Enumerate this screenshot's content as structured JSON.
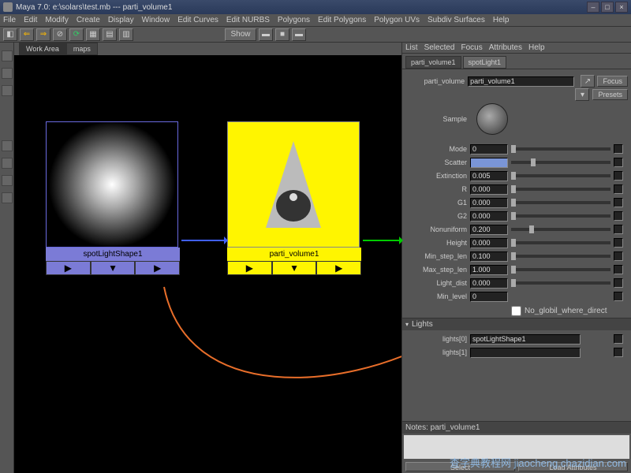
{
  "title": "Maya 7.0: e:\\solars\\test.mb --- parti_volume1",
  "menus": [
    "File",
    "Edit",
    "Modify",
    "Create",
    "Display",
    "Window",
    "Edit Curves",
    "Edit NURBS",
    "Polygons",
    "Edit Polygons",
    "Polygon UVs",
    "Subdiv Surfaces",
    "Help"
  ],
  "graph": {
    "tabs": [
      "Work Area",
      "maps"
    ],
    "node1_label": "spotLightShape1",
    "node2_label": "parti_volume1",
    "toolbar_show": "Show"
  },
  "attr": {
    "menus": [
      "List",
      "Selected",
      "Focus",
      "Attributes",
      "Help"
    ],
    "tabs": [
      "parti_volume1",
      "spotLight1"
    ],
    "node_row": {
      "label": "parti_volume",
      "value": "parti_volume1"
    },
    "buttons": {
      "focus": "Focus",
      "presets": "Presets"
    },
    "sample_label": "Sample",
    "section_lights": "Lights",
    "notes_label": "Notes: parti_volume1",
    "params": [
      {
        "label": "Mode",
        "value": "0",
        "thumb": 0
      },
      {
        "label": "Scatter",
        "value": "",
        "thumb": 20,
        "hl": true
      },
      {
        "label": "Extinction",
        "value": "0.005",
        "thumb": 0
      },
      {
        "label": "R",
        "value": "0.000",
        "thumb": 0
      },
      {
        "label": "G1",
        "value": "0.000",
        "thumb": 0
      },
      {
        "label": "G2",
        "value": "0.000",
        "thumb": 0
      },
      {
        "label": "Nonuniform",
        "value": "0.200",
        "thumb": 18
      },
      {
        "label": "Height",
        "value": "0.000",
        "thumb": 0
      },
      {
        "label": "Min_step_len",
        "value": "0.100",
        "thumb": 0
      },
      {
        "label": "Max_step_len",
        "value": "1.000",
        "thumb": 0
      },
      {
        "label": "Light_dist",
        "value": "0.000",
        "thumb": 0
      },
      {
        "label": "Min_level",
        "value": "0",
        "thumb": null
      }
    ],
    "checkbox_label": "No_globil_where_direct",
    "lights": [
      {
        "label": "lights[0]",
        "value": "spotLightShape1"
      },
      {
        "label": "lights[1]",
        "value": ""
      }
    ]
  },
  "watermark": "查字典教程网\njiaocheng.chazidian.com"
}
